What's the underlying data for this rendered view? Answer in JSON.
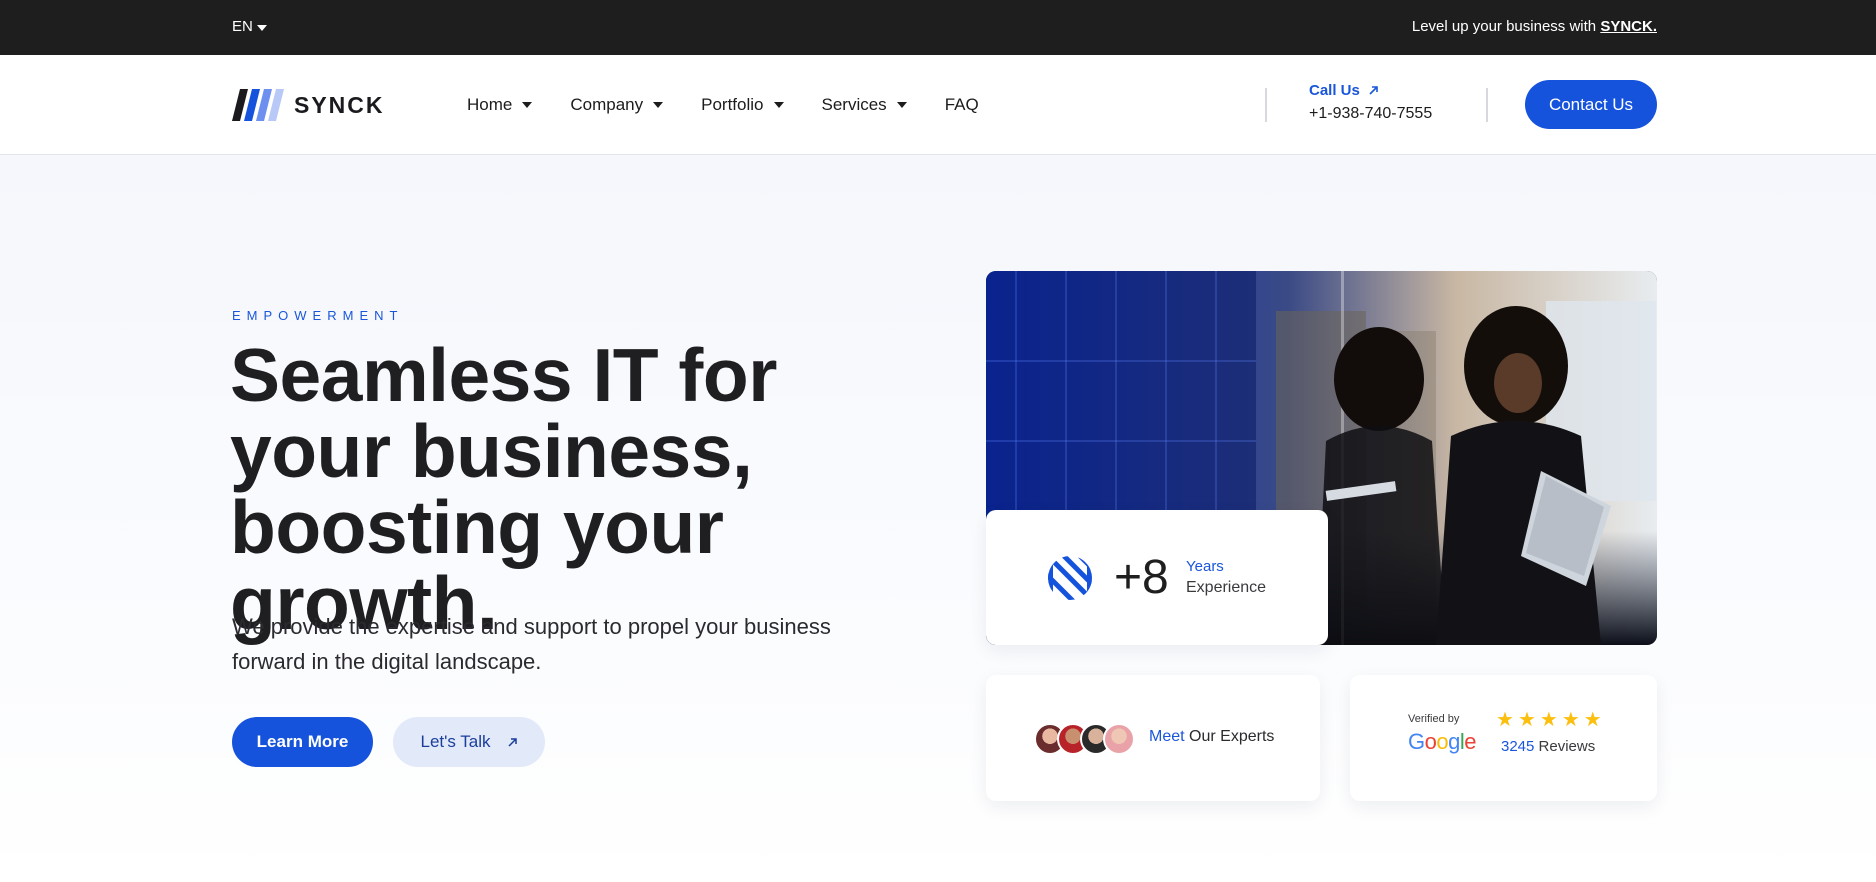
{
  "topbar": {
    "language": "EN",
    "promo_text": "Level up your business with",
    "promo_brand": "SYNCK."
  },
  "navbar": {
    "logo_text": "SYNCK",
    "menu": [
      {
        "label": "Home",
        "dropdown": true
      },
      {
        "label": "Company",
        "dropdown": true
      },
      {
        "label": "Portfolio",
        "dropdown": true
      },
      {
        "label": "Services",
        "dropdown": true
      },
      {
        "label": "FAQ",
        "dropdown": false
      }
    ],
    "call_label": "Call Us",
    "phone": "+1-938-740-7555",
    "contact_button": "Contact Us"
  },
  "hero": {
    "eyebrow": "EMPOWERMENT",
    "headline": "Seamless IT for your business, boosting your growth.",
    "subtext": "We provide the expertise and support to propel your business forward in the digital landscape.",
    "primary_button": "Learn More",
    "secondary_button": "Let's Talk"
  },
  "stats": {
    "years_value": "+8",
    "years_label": "Years",
    "years_sub": "Experience"
  },
  "experts": {
    "highlight": "Meet",
    "rest": "Our Experts"
  },
  "reviews": {
    "verified_by": "Verified by",
    "provider": "Google",
    "stars": 5,
    "count": "3245",
    "count_label": "Reviews"
  },
  "colors": {
    "accent": "#1553dc",
    "topbar_bg": "#1e1e1e",
    "star": "#fbbf0f"
  }
}
